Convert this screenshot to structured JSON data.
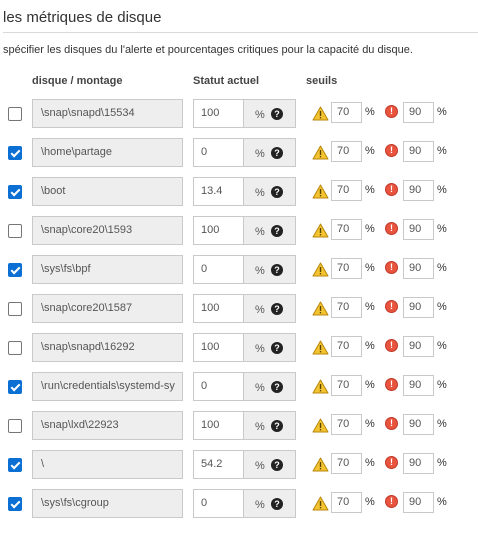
{
  "page": {
    "title": "les métriques de disque",
    "description": "spécifier les disques du l'alerte et pourcentages critiques pour la capacité du disque."
  },
  "table": {
    "headers": {
      "disk": "disque / montage",
      "status": "Statut actuel",
      "thresholds": "seuils"
    },
    "unit": "%",
    "help_glyph": "?",
    "critical_glyph": "!",
    "icons": {
      "help": "question-circle-icon",
      "warning": "warning-triangle-icon",
      "critical": "critical-circle-icon"
    },
    "colors": {
      "checkbox_checked": "#0b6fd4",
      "warning": "#f4c430",
      "critical": "#e8543d"
    },
    "rows": [
      {
        "checked": false,
        "mount": "\\snap\\snapd\\15534",
        "status": "100",
        "warning": "70",
        "critical": "90"
      },
      {
        "checked": true,
        "mount": "\\home\\partage",
        "status": "0",
        "warning": "70",
        "critical": "90"
      },
      {
        "checked": true,
        "mount": "\\boot",
        "status": "13.4",
        "warning": "70",
        "critical": "90"
      },
      {
        "checked": false,
        "mount": "\\snap\\core20\\1593",
        "status": "100",
        "warning": "70",
        "critical": "90"
      },
      {
        "checked": true,
        "mount": "\\sys\\fs\\bpf",
        "status": "0",
        "warning": "70",
        "critical": "90"
      },
      {
        "checked": false,
        "mount": "\\snap\\core20\\1587",
        "status": "100",
        "warning": "70",
        "critical": "90"
      },
      {
        "checked": false,
        "mount": "\\snap\\snapd\\16292",
        "status": "100",
        "warning": "70",
        "critical": "90"
      },
      {
        "checked": true,
        "mount": "\\run\\credentials\\systemd-sy",
        "status": "0",
        "warning": "70",
        "critical": "90"
      },
      {
        "checked": false,
        "mount": "\\snap\\lxd\\22923",
        "status": "100",
        "warning": "70",
        "critical": "90"
      },
      {
        "checked": true,
        "mount": "\\",
        "status": "54.2",
        "warning": "70",
        "critical": "90"
      },
      {
        "checked": true,
        "mount": "\\sys\\fs\\cgroup",
        "status": "0",
        "warning": "70",
        "critical": "90"
      }
    ]
  }
}
